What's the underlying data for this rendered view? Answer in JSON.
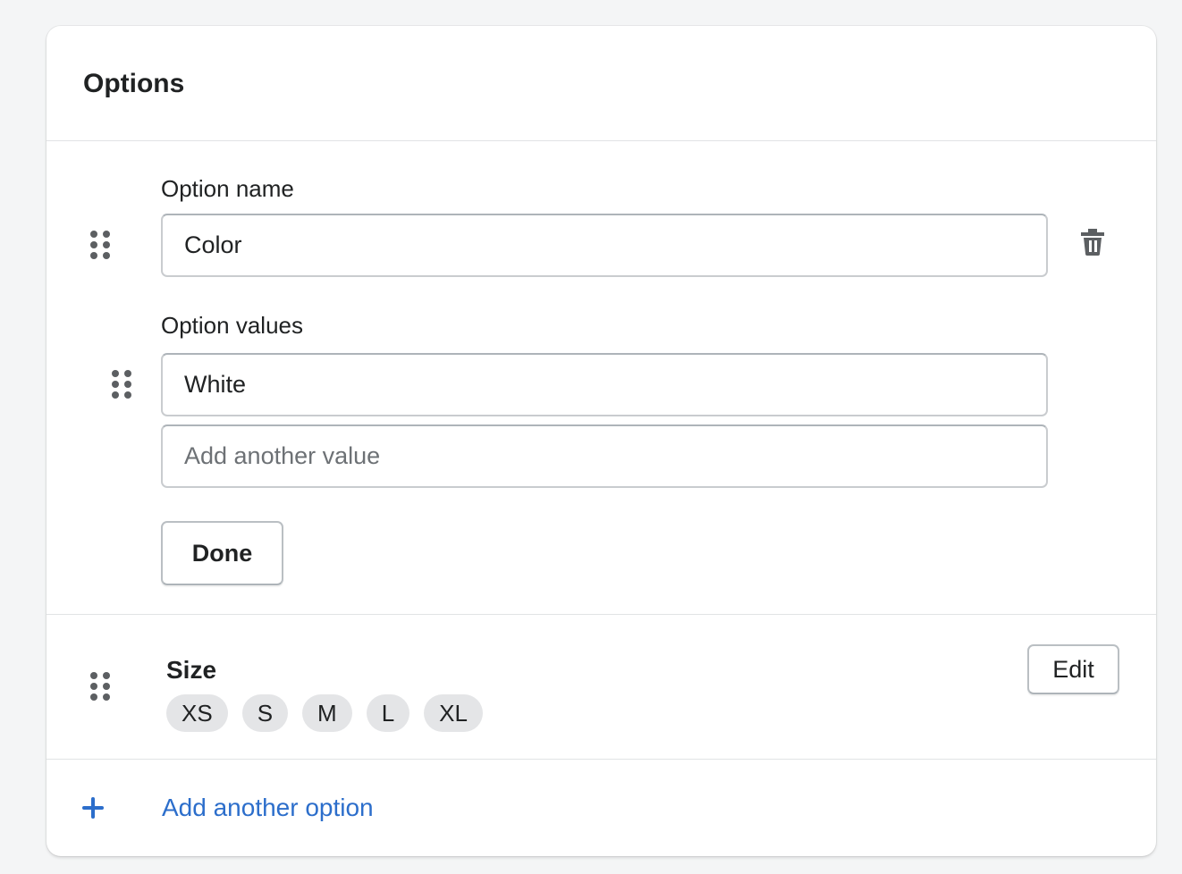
{
  "card": {
    "title": "Options"
  },
  "option_editor": {
    "name_label": "Option name",
    "name_value": "Color",
    "values_label": "Option values",
    "values": [
      "White"
    ],
    "new_value_placeholder": "Add another value",
    "done_label": "Done",
    "delete_icon": "trash-icon"
  },
  "option_summary": {
    "name": "Size",
    "values": [
      "XS",
      "S",
      "M",
      "L",
      "XL"
    ],
    "edit_label": "Edit"
  },
  "footer": {
    "add_option_label": "Add another option",
    "add_icon": "plus-icon"
  },
  "colors": {
    "accent": "#2c6ecb",
    "background": "#f4f5f6",
    "tag_background": "#e4e5e7"
  }
}
